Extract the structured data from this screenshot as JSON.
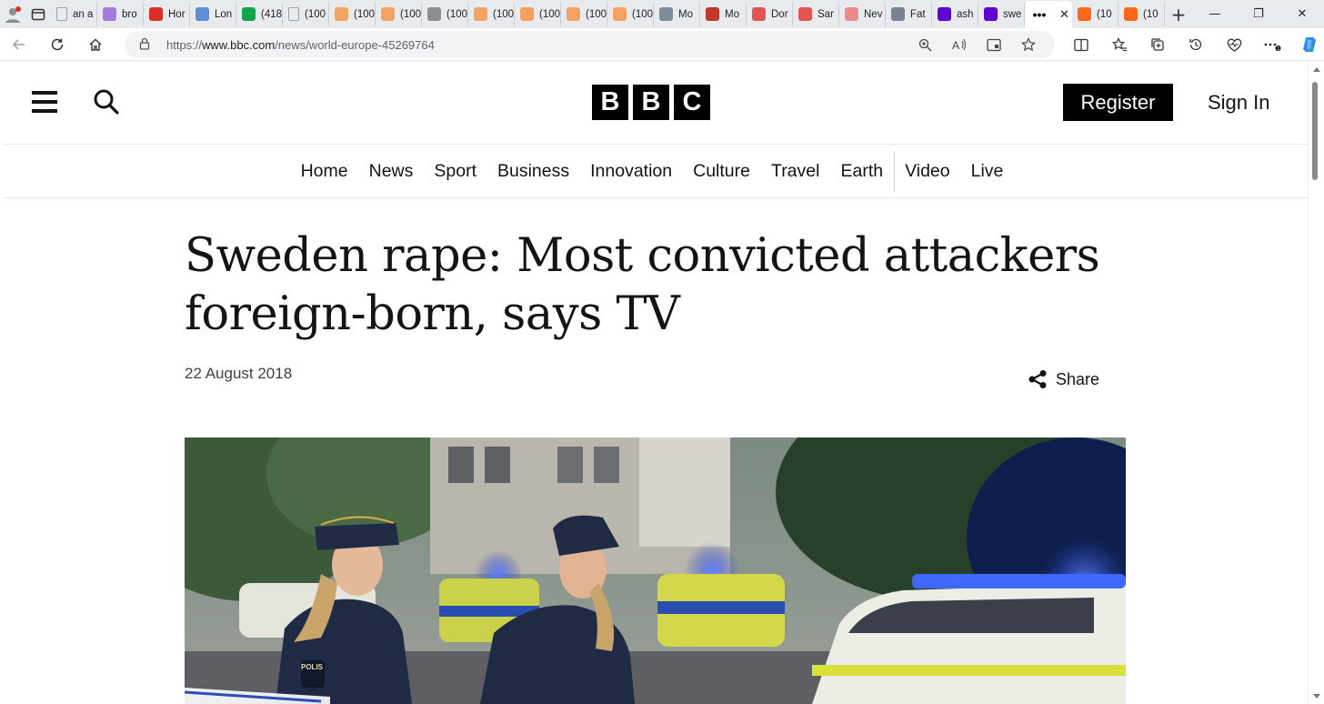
{
  "browser": {
    "tabs": [
      {
        "label": "an a",
        "icon": "document-icon",
        "color": "#9aa0a6"
      },
      {
        "label": "bro",
        "icon": "yahoo-icon",
        "color": "#a67be0"
      },
      {
        "label": "Hor",
        "icon": "red-shield-icon",
        "color": "#d93025"
      },
      {
        "label": "Lon",
        "icon": "five-icon",
        "color": "#5b8fd6"
      },
      {
        "label": "(418",
        "icon": "grammarly-icon",
        "color": "#16a34a"
      },
      {
        "label": "(100",
        "icon": "document-icon",
        "color": "#9aa0a6"
      },
      {
        "label": "(100",
        "icon": "substack-icon",
        "color": "#f4a261"
      },
      {
        "label": "(100",
        "icon": "substack-icon",
        "color": "#f4a261"
      },
      {
        "label": "(100",
        "icon": "globe-icon",
        "color": "#8d8d8d"
      },
      {
        "label": "(100",
        "icon": "substack-icon",
        "color": "#f4a261"
      },
      {
        "label": "(100",
        "icon": "substack-icon",
        "color": "#f4a261"
      },
      {
        "label": "(100",
        "icon": "substack-icon",
        "color": "#f4a261"
      },
      {
        "label": "(100",
        "icon": "substack-icon",
        "color": "#f4a261"
      },
      {
        "label": "Mo",
        "icon": "wordpress-icon",
        "color": "#7b8c9a"
      },
      {
        "label": "Mo",
        "icon": "bi-icon",
        "color": "#c0392b"
      },
      {
        "label": "Dor",
        "icon": "youtube-icon",
        "color": "#e25555"
      },
      {
        "label": "Sar",
        "icon": "youtube-icon",
        "color": "#e25555"
      },
      {
        "label": "Nev",
        "icon": "t-icon",
        "color": "#e88c8c"
      },
      {
        "label": "Fat",
        "icon": "play-icon",
        "color": "#7a8190"
      },
      {
        "label": "ash",
        "icon": "yahoo-icon",
        "color": "#5f01d1"
      },
      {
        "label": "swe",
        "icon": "yahoo-icon",
        "color": "#5f01d1"
      },
      {
        "label": "",
        "icon": "dots-icon",
        "color": "#000000",
        "active": true
      },
      {
        "label": "(10",
        "icon": "substack-icon",
        "color": "#ff6719"
      },
      {
        "label": "(10",
        "icon": "substack-icon",
        "color": "#ff6719"
      }
    ],
    "url_prefix": "https://",
    "url_host": "www.bbc.com",
    "url_path": "/news/world-europe-45269764"
  },
  "site": {
    "logo_letters": [
      "B",
      "B",
      "C"
    ],
    "register_label": "Register",
    "signin_label": "Sign In",
    "nav": [
      "Home",
      "News",
      "Sport",
      "Business",
      "Innovation",
      "Culture",
      "Travel",
      "Earth",
      "Video",
      "Live"
    ]
  },
  "article": {
    "headline_line1": "Sweden rape: Most convicted attackers",
    "headline_line2": "foreign-born, says TV",
    "date": "22 August 2018",
    "share_label": "Share"
  },
  "hero_image": {
    "text": "POLIS",
    "colors": {
      "uniform": "#1f2a44",
      "police_blue": "#1e3fd8",
      "siren": "#3d6bff",
      "car_yellow": "#d8e23a"
    }
  }
}
